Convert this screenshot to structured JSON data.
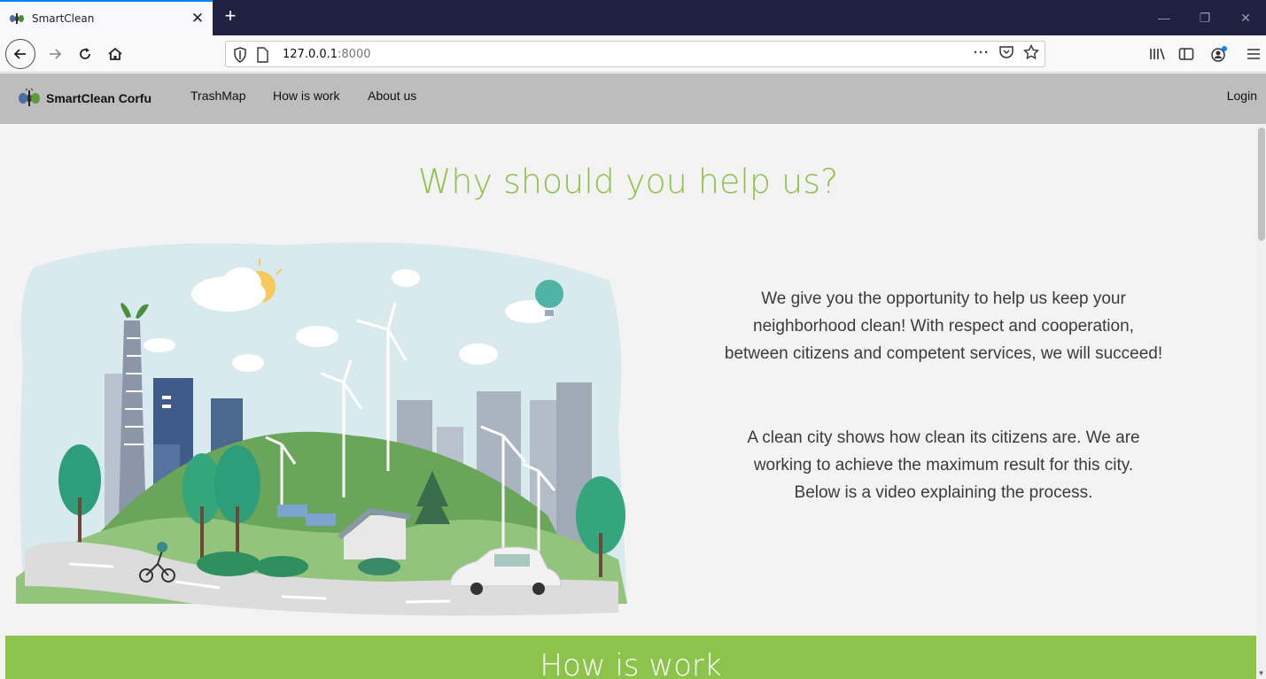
{
  "browser": {
    "tab_title": "SmartClean",
    "url_host": "127.0.0.1",
    "url_port": ":8000"
  },
  "site": {
    "brand": "SmartClean Corfu",
    "menu": [
      "TrashMap",
      "How is work",
      "About us"
    ],
    "login": "Login"
  },
  "hero": {
    "title": "Why should you help us?",
    "paragraph_1": [
      "We give you the opportunity to help us keep your",
      "neighborhood clean! With respect and cooperation,",
      "between citizens and competent services, we will succeed!"
    ],
    "paragraph_2": [
      "A clean city shows how clean its citizens are. We are",
      "working to achieve the maximum result for this city.",
      "Below is a video explaining the process."
    ]
  },
  "how_section": {
    "title": "How is work"
  },
  "colors": {
    "accent_green": "#8cc34b",
    "header_gray": "#bdbdbd",
    "tabbar": "#1f2141"
  },
  "icons": [
    "back-arrow-icon",
    "forward-arrow-icon",
    "reload-icon",
    "home-icon",
    "shield-icon",
    "page-icon",
    "more-dots-icon",
    "pocket-icon",
    "bookmark-star-icon",
    "library-icon",
    "sidebar-icon",
    "account-icon",
    "hamburger-menu-icon"
  ]
}
